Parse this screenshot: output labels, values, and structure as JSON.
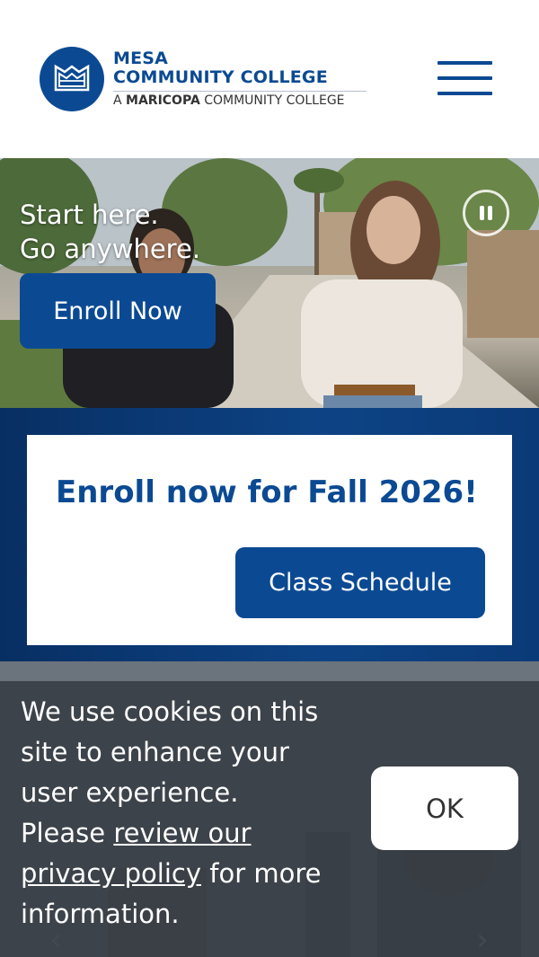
{
  "header": {
    "logo": {
      "line1": "MESA",
      "line2": "COMMUNITY COLLEGE",
      "line3_prefix": "A ",
      "line3_bold": "MARICOPA",
      "line3_suffix": " COMMUNITY COLLEGE"
    },
    "menu_icon": "hamburger-menu-icon"
  },
  "hero": {
    "headline_line1": "Start here.",
    "headline_line2": "Go anywhere.",
    "enroll_button": "Enroll Now",
    "pause_icon": "pause-icon"
  },
  "promo": {
    "title": "Enroll now for Fall 2026!",
    "button": "Class Schedule"
  },
  "carousel": {
    "prev_icon": "chevron-left-icon",
    "next_icon": "chevron-right-icon"
  },
  "cookie": {
    "text_before": "We use cookies on this site to enhance your user experience. Please ",
    "link": "review our privacy policy",
    "text_after": " for more information.",
    "ok_button": "OK"
  },
  "colors": {
    "brand_blue": "#0b4a93",
    "promo_band": "#0d4385",
    "cookie_bg": "#3a4046"
  }
}
